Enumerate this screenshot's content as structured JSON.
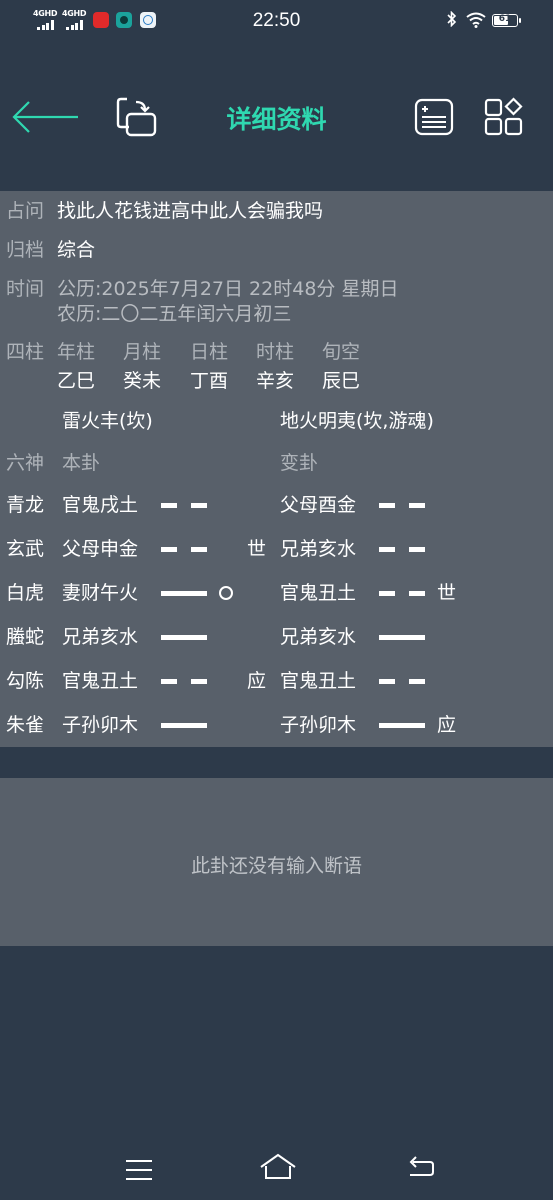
{
  "status_bar": {
    "signal_1": "4GHD",
    "signal_2": "4GHD",
    "time": "22:50",
    "battery": "61",
    "icons": [
      "bluetooth-icon",
      "wifi-icon",
      "battery-icon"
    ]
  },
  "header": {
    "title": "详细资料",
    "back_icon": "arrow-left-icon",
    "copy_icon": "copy-icon",
    "list_icon": "add-note-icon",
    "grid_icon": "apps-grid-icon",
    "accent_color": "#2fd8b0"
  },
  "info": {
    "question_label": "占问",
    "question": "找此人花钱进高中此人会骗我吗",
    "category_label": "归档",
    "category": "综合",
    "time_label": "时间",
    "solar": "公历:2025年7月27日  22时48分 星期日",
    "lunar": "农历:二〇二五年闰六月初三",
    "pillars_label": "四柱",
    "pillar_headers": [
      "年柱",
      "月柱",
      "日柱",
      "时柱",
      "旬空"
    ],
    "pillar_values": [
      "乙巳",
      "癸未",
      "丁酉",
      "辛亥",
      "辰巳"
    ]
  },
  "hexagram": {
    "main_name": "雷火丰(坎)",
    "changed_name": "地火明夷(坎,游魂)",
    "spirits_label": "六神",
    "main_label": "本卦",
    "changed_label": "变卦",
    "lines": [
      {
        "spirit": "青龙",
        "main": "官鬼戌土",
        "main_type": "yin",
        "moving": false,
        "main_mark": "",
        "changed": "父母酉金",
        "changed_type": "yin",
        "changed_mark": ""
      },
      {
        "spirit": "玄武",
        "main": "父母申金",
        "main_type": "yin",
        "moving": false,
        "main_mark": "世",
        "changed": "兄弟亥水",
        "changed_type": "yin",
        "changed_mark": ""
      },
      {
        "spirit": "白虎",
        "main": "妻财午火",
        "main_type": "yang",
        "moving": true,
        "main_mark": "",
        "changed": "官鬼丑土",
        "changed_type": "yin",
        "changed_mark": "世"
      },
      {
        "spirit": "螣蛇",
        "main": "兄弟亥水",
        "main_type": "yang",
        "moving": false,
        "main_mark": "",
        "changed": "兄弟亥水",
        "changed_type": "yang",
        "changed_mark": ""
      },
      {
        "spirit": "勾陈",
        "main": "官鬼丑土",
        "main_type": "yin",
        "moving": false,
        "main_mark": "应",
        "changed": "官鬼丑土",
        "changed_type": "yin",
        "changed_mark": ""
      },
      {
        "spirit": "朱雀",
        "main": "子孙卯木",
        "main_type": "yang",
        "moving": false,
        "main_mark": "",
        "changed": "子孙卯木",
        "changed_type": "yang",
        "changed_mark": "应"
      }
    ]
  },
  "judgment": {
    "empty_text": "此卦还没有输入断语"
  },
  "nav_bar": {
    "menu_icon": "menu-icon",
    "home_icon": "home-icon",
    "back_icon": "back-icon"
  }
}
